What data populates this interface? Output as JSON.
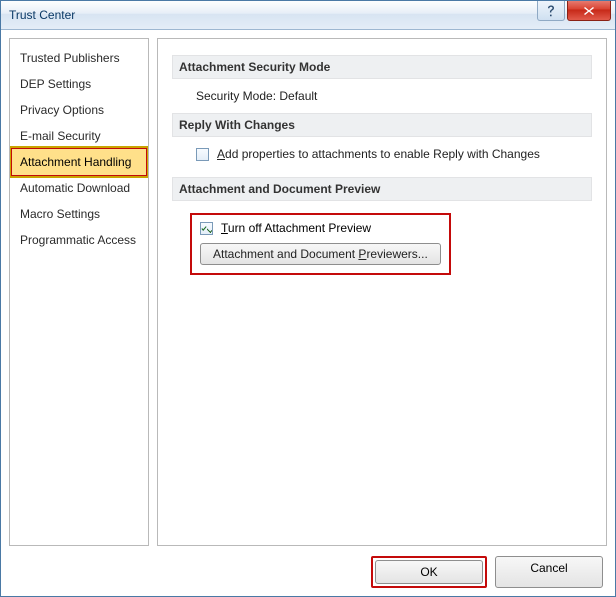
{
  "window": {
    "title": "Trust Center"
  },
  "sidebar": {
    "items": [
      {
        "label": "Trusted Publishers",
        "selected": false
      },
      {
        "label": "DEP Settings",
        "selected": false
      },
      {
        "label": "Privacy Options",
        "selected": false
      },
      {
        "label": "E-mail Security",
        "selected": false
      },
      {
        "label": "Attachment Handling",
        "selected": true
      },
      {
        "label": "Automatic Download",
        "selected": false
      },
      {
        "label": "Macro Settings",
        "selected": false
      },
      {
        "label": "Programmatic Access",
        "selected": false
      }
    ]
  },
  "sections": {
    "security_mode": {
      "header": "Attachment Security Mode",
      "value_label": "Security Mode: Default"
    },
    "reply_changes": {
      "header": "Reply With Changes",
      "checkbox_prefix": "A",
      "checkbox_rest": "dd properties to attachments to enable Reply with Changes",
      "checked": false
    },
    "preview": {
      "header": "Attachment and Document Preview",
      "checkbox_prefix": "T",
      "checkbox_rest": "urn off Attachment Preview",
      "checked": true,
      "button_before": "Attachment and Document ",
      "button_mnemonic": "P",
      "button_after": "reviewers..."
    }
  },
  "footer": {
    "ok": "OK",
    "cancel": "Cancel"
  }
}
